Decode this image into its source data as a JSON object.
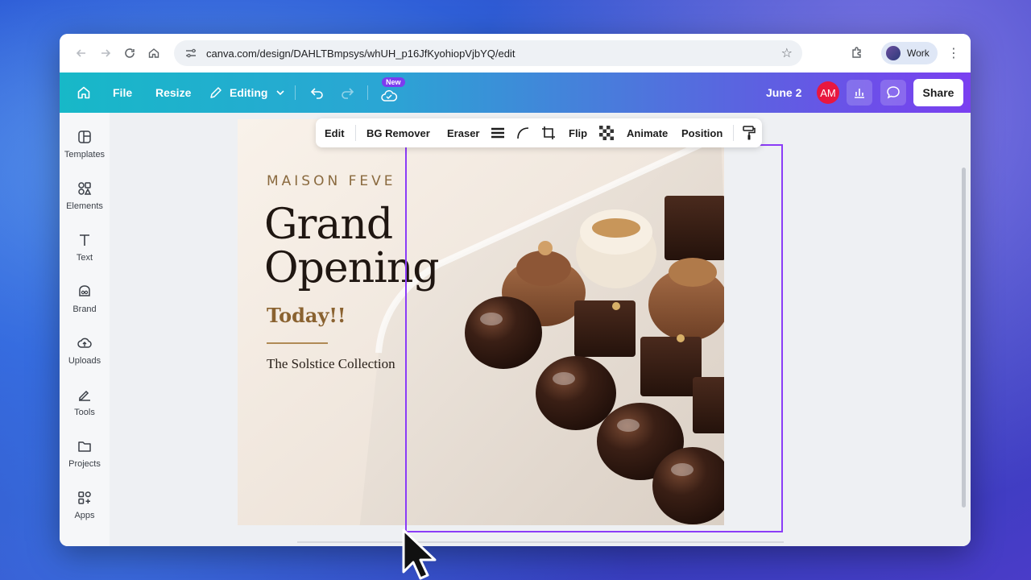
{
  "browser": {
    "url": "canva.com/design/DAHLTBmpsys/whUH_p16JfKyohiopVjbYQ/edit",
    "profile_label": "Work"
  },
  "header": {
    "file_label": "File",
    "resize_label": "Resize",
    "editing_label": "Editing",
    "new_badge": "New",
    "date_label": "June 2",
    "avatar_initials": "AM",
    "share_label": "Share"
  },
  "sidebar": {
    "items": [
      {
        "label": "Templates",
        "icon": "templates-icon"
      },
      {
        "label": "Elements",
        "icon": "elements-icon"
      },
      {
        "label": "Text",
        "icon": "text-icon"
      },
      {
        "label": "Brand",
        "icon": "brand-icon"
      },
      {
        "label": "Uploads",
        "icon": "uploads-icon"
      },
      {
        "label": "Tools",
        "icon": "tools-icon"
      },
      {
        "label": "Projects",
        "icon": "projects-icon"
      },
      {
        "label": "Apps",
        "icon": "apps-icon"
      }
    ]
  },
  "toolbar": {
    "edit": "Edit",
    "bg_remover": "BG Remover",
    "eraser": "Eraser",
    "flip": "Flip",
    "animate": "Animate",
    "position": "Position"
  },
  "design": {
    "brand": "MAISON FEVE",
    "headline_line1": "Grand",
    "headline_line2": "Opening",
    "tagline": "Today!!",
    "collection": "The Solstice Collection"
  },
  "colors": {
    "selection": "#8b3cf7",
    "share_bg": "#ffffff",
    "avatar_bg": "#e8173f",
    "accent_gold": "#8a6230"
  }
}
